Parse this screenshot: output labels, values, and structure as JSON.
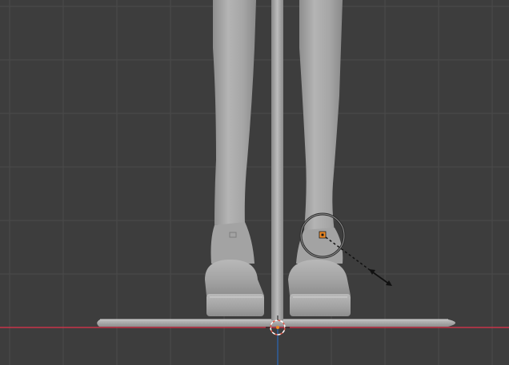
{
  "viewport": {
    "background": "#3d3d3d",
    "grid_color": "#4a4a4a",
    "grid_major_color": "#545454",
    "x_axis_color": "#c8344a",
    "z_axis_color": "#2e5f9e",
    "mesh_base_color": "#a9a9a9",
    "mesh_shadow_color": "#8c8c8c",
    "mesh_highlight_color": "#c4c4c4",
    "selection_color": "#f08a24",
    "cursor_ring_color": "#e05a4a"
  },
  "scene": {
    "object": "mannequin-legs-on-stand",
    "tool": "scale-brush-cursor"
  }
}
